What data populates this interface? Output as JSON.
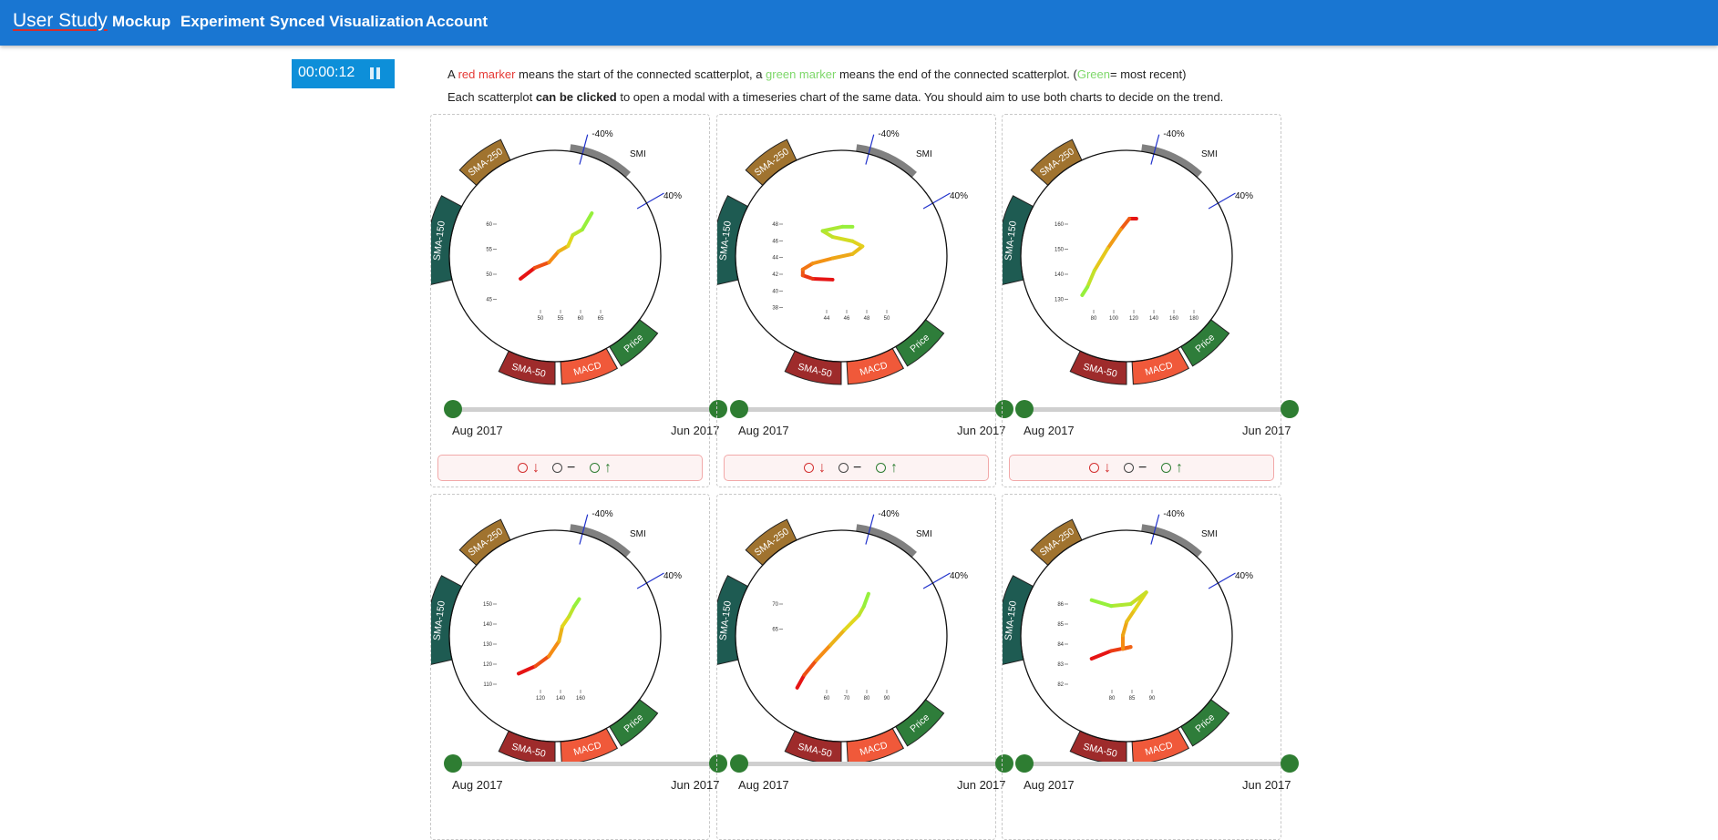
{
  "nav": {
    "brand": "User Study",
    "links": [
      "Mockup",
      "Experiment",
      "Synced Visualization",
      "Account"
    ]
  },
  "timer": {
    "value": "00:00:12",
    "icon": "pause-icon"
  },
  "instructions": {
    "line1": {
      "p1": "A ",
      "red": "red marker",
      "p2": " means the start of the connected scatterplot, a ",
      "green": "green marker",
      "p3": " means the end of the connected scatterplot. (",
      "green2": "Green",
      "p4": "= most recent)"
    },
    "line2": {
      "p1": "Each scatterplot ",
      "bold": "can be clicked",
      "p2": " to open a modal with a timeseries chart of the same data. You should aim to use both charts to decide on the trend."
    }
  },
  "ring_labels": {
    "smi": "SMI",
    "neg": "-40%",
    "pos": "40%",
    "sma250": "SMA-250",
    "sma150": "SMA-150",
    "sma50": "SMA-50",
    "macd": "MACD",
    "price": "Price"
  },
  "colors": {
    "nav": "#1976d2",
    "sma250": "#a0732f",
    "sma150": "#1e5b52",
    "sma50": "#9e2b2b",
    "macd": "#f0593a",
    "price": "#2e7d3a",
    "smi": "#808080",
    "knob": "#2e7d32"
  },
  "slider": {
    "start": "Aug 2017",
    "end": "Jun 2017"
  },
  "vote_icons": [
    "down-arrow",
    "dash",
    "up-arrow"
  ],
  "cards": [
    {
      "yticks": [
        "60",
        "55",
        "50",
        "45"
      ],
      "xticks": [
        "50",
        "55",
        "60",
        "65"
      ],
      "path": [
        [
          50,
          50
        ],
        [
          53,
          52
        ],
        [
          56,
          53
        ],
        [
          58,
          55
        ],
        [
          60,
          56
        ],
        [
          61,
          58
        ],
        [
          63,
          59
        ],
        [
          65,
          62
        ]
      ],
      "xr": [
        45,
        68
      ],
      "yr": [
        40,
        65
      ]
    },
    {
      "yticks": [
        "48",
        "46",
        "44",
        "42",
        "40",
        "38"
      ],
      "xticks": [
        "44",
        "46",
        "48",
        "50"
      ],
      "path": [
        [
          47,
          42.3
        ],
        [
          45,
          42.4
        ],
        [
          44,
          42.8
        ],
        [
          44,
          43.5
        ],
        [
          45,
          44.2
        ],
        [
          47,
          44.8
        ],
        [
          49,
          45.3
        ],
        [
          50,
          46.2
        ],
        [
          49,
          46.8
        ],
        [
          47,
          47.3
        ],
        [
          46,
          48
        ],
        [
          48,
          48.5
        ],
        [
          49,
          48.5
        ]
      ],
      "xr": [
        42,
        53
      ],
      "yr": [
        36,
        52
      ]
    },
    {
      "yticks": [
        "160",
        "150",
        "140",
        "130"
      ],
      "xticks": [
        "80",
        "100",
        "120",
        "140",
        "160",
        "180"
      ],
      "path": [
        [
          148,
          167
        ],
        [
          140,
          167
        ],
        [
          130,
          163
        ],
        [
          115,
          156
        ],
        [
          100,
          148
        ],
        [
          92,
          142
        ],
        [
          86,
          139
        ]
      ],
      "xr": [
        70,
        195
      ],
      "yr": [
        125,
        175
      ]
    },
    {
      "yticks": [
        "150",
        "140",
        "130",
        "120",
        "110"
      ],
      "xticks": [
        "120",
        "140",
        "160"
      ],
      "path": [
        [
          118,
          121
        ],
        [
          128,
          124
        ],
        [
          136,
          128
        ],
        [
          142,
          134
        ],
        [
          144,
          140
        ],
        [
          148,
          144
        ],
        [
          151,
          148
        ],
        [
          154,
          151
        ]
      ],
      "xr": [
        105,
        170
      ],
      "yr": [
        105,
        160
      ]
    },
    {
      "yticks": [
        "70",
        "65"
      ],
      "xticks": [
        "60",
        "70",
        "80",
        "90"
      ],
      "path": [
        [
          58,
          65
        ],
        [
          61,
          66.5
        ],
        [
          66,
          68.2
        ],
        [
          72,
          70
        ],
        [
          78,
          71.8
        ],
        [
          84,
          73.5
        ],
        [
          86,
          74.5
        ],
        [
          88,
          76
        ]
      ],
      "xr": [
        52,
        98
      ],
      "yr": [
        62,
        78
      ]
    },
    {
      "yticks": [
        "86",
        "85",
        "84",
        "83",
        "82"
      ],
      "xticks": [
        "80",
        "85",
        "90"
      ],
      "path": [
        [
          76,
          83.8
        ],
        [
          81,
          84.2
        ],
        [
          86,
          84.4
        ],
        [
          84,
          84.3
        ],
        [
          84,
          85
        ],
        [
          85,
          85.7
        ],
        [
          87,
          86.3
        ],
        [
          90,
          87.2
        ],
        [
          86,
          86.6
        ],
        [
          81,
          86.5
        ],
        [
          76,
          86.8
        ]
      ],
      "xr": [
        70,
        98
      ],
      "yr": [
        81,
        88
      ]
    }
  ]
}
